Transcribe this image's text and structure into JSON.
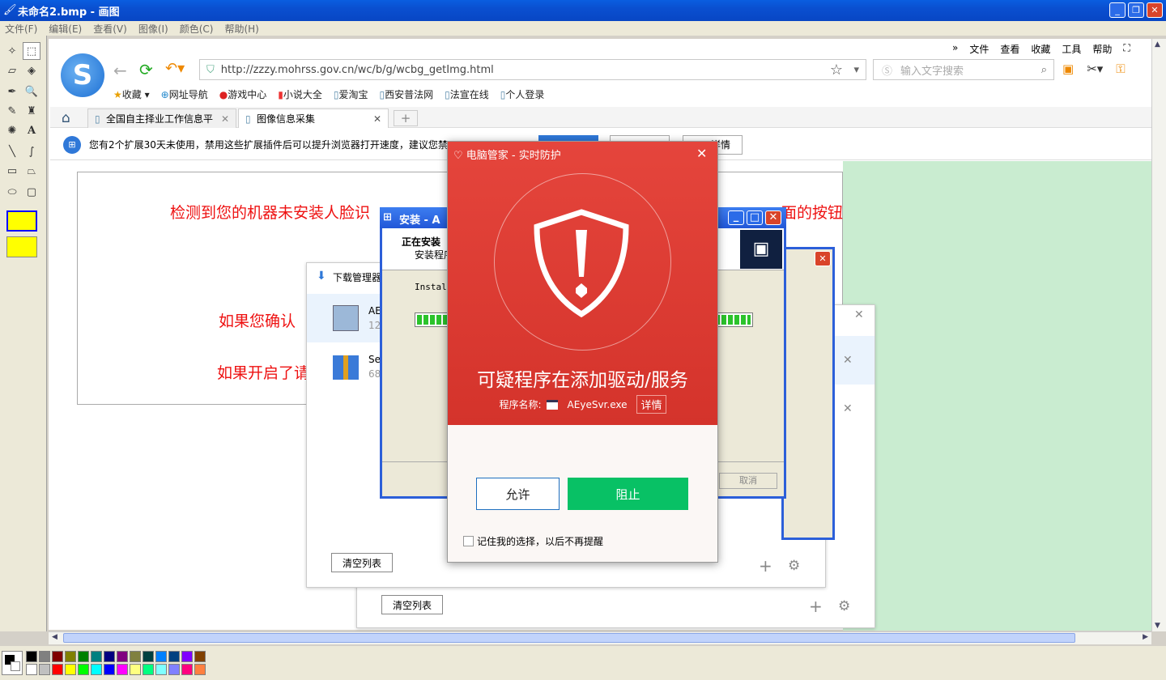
{
  "window": {
    "title": "未命名2.bmp - 画图"
  },
  "menu": [
    "文件(F)",
    "编辑(E)",
    "查看(V)",
    "图像(I)",
    "颜色(C)",
    "帮助(H)"
  ],
  "browser": {
    "url": "http://zzzy.mohrss.gov.cn/wc/b/g/wcbg_getImg.html",
    "search_placeholder": "输入文字搜索",
    "topmenu": [
      "文件",
      "查看",
      "收藏",
      "工具",
      "帮助"
    ],
    "bookmarks": [
      "收藏",
      "网址导航",
      "游戏中心",
      "小说大全",
      "爱淘宝",
      "西安普法网",
      "法宣在线",
      "个人登录"
    ],
    "tabs": [
      "全国自主择业工作信息平",
      "图像信息采集"
    ],
    "notification": "您有2个扩展30天未使用，禁用这些扩展插件后可以提升浏览器打开速度，建议您禁",
    "notif_btn": "详情"
  },
  "page": {
    "line1": "检测到您的机器未安装人脸识",
    "line1b": "面的按钮",
    "line2": "如果您确认",
    "line3": "如果开启了请"
  },
  "download": {
    "title": "下载管理器",
    "item1": "AE",
    "item1sub": "12",
    "item2": "Se",
    "item2sub": "68",
    "clear": "清空列表"
  },
  "installer": {
    "title": "安装 - A",
    "heading": "正在安装",
    "sub": "安装程序",
    "status": "Install",
    "cancel": "取消"
  },
  "dialog": {
    "title": "电脑管家 - 实时防护",
    "headline": "可疑程序在添加驱动/服务",
    "prog_label": "程序名称:",
    "prog_name": "AEyeSvr.exe",
    "details": "详情",
    "allow": "允许",
    "block": "阻止",
    "remember": "记住我的选择，以后不再提醒"
  },
  "palette": [
    "#000000",
    "#808080",
    "#800000",
    "#808000",
    "#008000",
    "#008080",
    "#000080",
    "#800080",
    "#808040",
    "#004040",
    "#0080ff",
    "#004080",
    "#8000ff",
    "#804000",
    "#ffffff",
    "#c0c0c0",
    "#ff0000",
    "#ffff00",
    "#00ff00",
    "#00ffff",
    "#0000ff",
    "#ff00ff",
    "#ffff80",
    "#00ff80",
    "#80ffff",
    "#8080ff",
    "#ff0080",
    "#ff8040"
  ]
}
